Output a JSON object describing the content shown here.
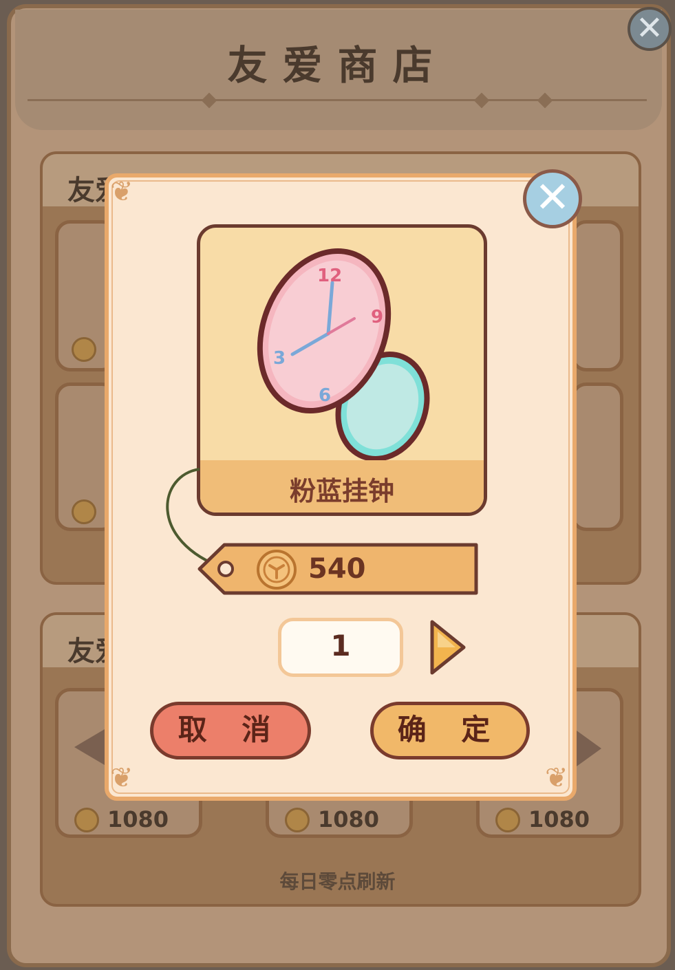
{
  "shop": {
    "title": "友爱商店",
    "section_label": "友爱",
    "refresh_note": "每日零点刷新",
    "prices": [
      "1080",
      "1080",
      "1080"
    ]
  },
  "dialog": {
    "item_name": "粉蓝挂钟",
    "price": "540",
    "quantity": "1",
    "cancel_label": "取 消",
    "confirm_label": "确 定"
  },
  "icons": {
    "close": "close-icon",
    "coin": "coin-icon",
    "next": "arrow-right-icon"
  },
  "colors": {
    "cancel_button": "#ec7f6a",
    "confirm_button": "#f1b869",
    "dialog_bg": "#fbe7d1",
    "dialog_border": "#e9a96b"
  }
}
